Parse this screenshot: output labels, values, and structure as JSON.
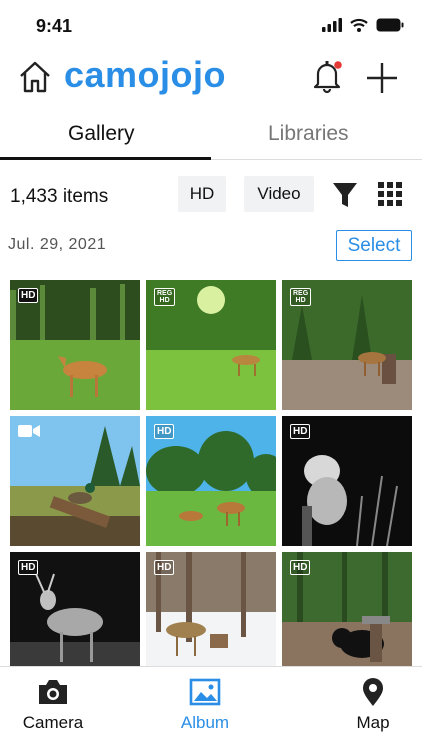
{
  "status_bar": {
    "time": "9:41"
  },
  "header": {
    "logo": "camojojo"
  },
  "tabs": [
    {
      "label": "Gallery",
      "active": true
    },
    {
      "label": "Libraries",
      "active": false
    }
  ],
  "toolbar": {
    "item_count": "1,433 items",
    "filter_hd": "HD",
    "filter_video": "Video",
    "filter_icon": "filter-icon",
    "grid_icon": "grid-view-icon"
  },
  "section": {
    "date": "Jul. 29,  2021",
    "select_label": "Select"
  },
  "photos": [
    {
      "badge": "HD",
      "badge_style": "dark-fill",
      "scene": "deer in green field"
    },
    {
      "badge": "REG HD",
      "badge_style": "outline",
      "scene": "deer crossing sunny meadow"
    },
    {
      "badge": "REG HD",
      "badge_style": "outline",
      "scene": "deer near stump in forest"
    },
    {
      "badge": "video",
      "badge_style": "video",
      "scene": "duck on log by pond"
    },
    {
      "badge": "HD",
      "badge_style": "outline",
      "scene": "deer grazing in meadow"
    },
    {
      "badge": "HD",
      "badge_style": "dark-fill",
      "scene": "raccoon at night"
    },
    {
      "badge": "HD",
      "badge_style": "dark-fill",
      "scene": "buck at night"
    },
    {
      "badge": "HD",
      "badge_style": "outline",
      "scene": "deer in snowy forest"
    },
    {
      "badge": "HD",
      "badge_style": "outline",
      "scene": "black bear at feeder"
    }
  ],
  "bottom_nav": [
    {
      "label": "Camera",
      "icon": "camera-icon",
      "active": false
    },
    {
      "label": "Album",
      "icon": "album-icon",
      "active": true
    },
    {
      "label": "Map",
      "icon": "map-pin-icon",
      "active": false
    }
  ],
  "colors": {
    "accent": "#2a8ee6",
    "notification_dot": "#e53935"
  }
}
